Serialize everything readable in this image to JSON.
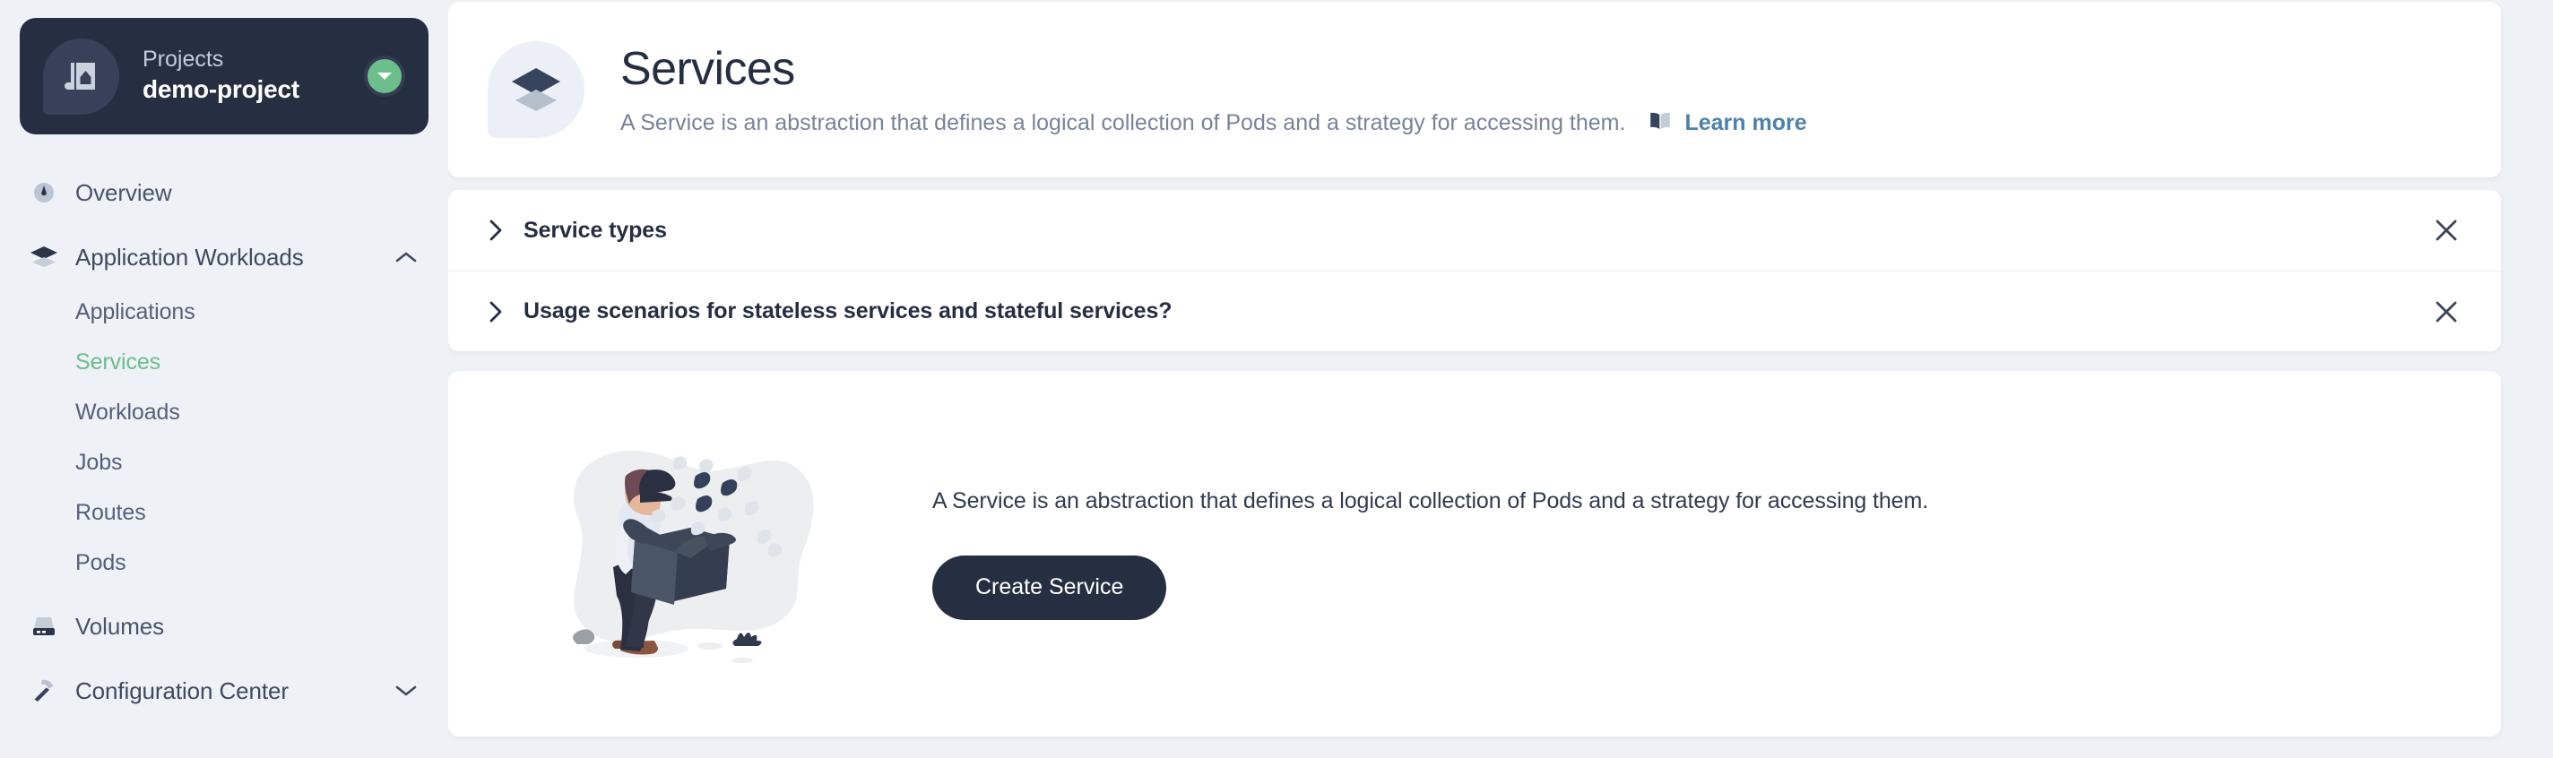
{
  "sidebar": {
    "project": {
      "label": "Projects",
      "name": "demo-project",
      "switch_icon": "chevron-down-circle-icon",
      "logo_icon": "project-blueprint-icon"
    },
    "items": [
      {
        "label": "Overview",
        "icon": "gauge-icon",
        "type": "leaf"
      },
      {
        "label": "Application Workloads",
        "icon": "layers-icon",
        "type": "group",
        "expanded": true,
        "caret": "chevron-up-icon"
      },
      {
        "label": "Applications",
        "type": "sub",
        "active": false
      },
      {
        "label": "Services",
        "type": "sub",
        "active": true
      },
      {
        "label": "Workloads",
        "type": "sub",
        "active": false
      },
      {
        "label": "Jobs",
        "type": "sub",
        "active": false
      },
      {
        "label": "Routes",
        "type": "sub",
        "active": false
      },
      {
        "label": "Pods",
        "type": "sub",
        "active": false
      },
      {
        "label": "Volumes",
        "icon": "hard-drive-icon",
        "type": "leaf"
      },
      {
        "label": "Configuration Center",
        "icon": "hammer-icon",
        "type": "group",
        "expanded": false,
        "caret": "chevron-down-icon"
      }
    ]
  },
  "header": {
    "logo_icon": "services-layers-icon",
    "title": "Services",
    "description": "A Service is an abstraction that defines a logical collection of Pods and a strategy for accessing them.",
    "learn_more_label": "Learn more",
    "learn_more_icon": "book-icon"
  },
  "accordion": {
    "rows": [
      {
        "title": "Service types",
        "chevron": "chevron-right-icon",
        "close_icon": "close-icon"
      },
      {
        "title": "Usage scenarios for stateless services and stateful services?",
        "chevron": "chevron-right-icon",
        "close_icon": "close-icon"
      }
    ]
  },
  "empty_state": {
    "illustration": "person-with-empty-box-illustration",
    "description": "A Service is an abstraction that defines a logical collection of Pods and a strategy for accessing them.",
    "create_button_label": "Create Service"
  },
  "colors": {
    "page_background": "#eef1f6",
    "card_background": "#ffffff",
    "dark_navy": "#262e41",
    "accent_green": "#6cbe8b",
    "link_blue": "#4c82ab",
    "muted_text": "#78839a"
  }
}
